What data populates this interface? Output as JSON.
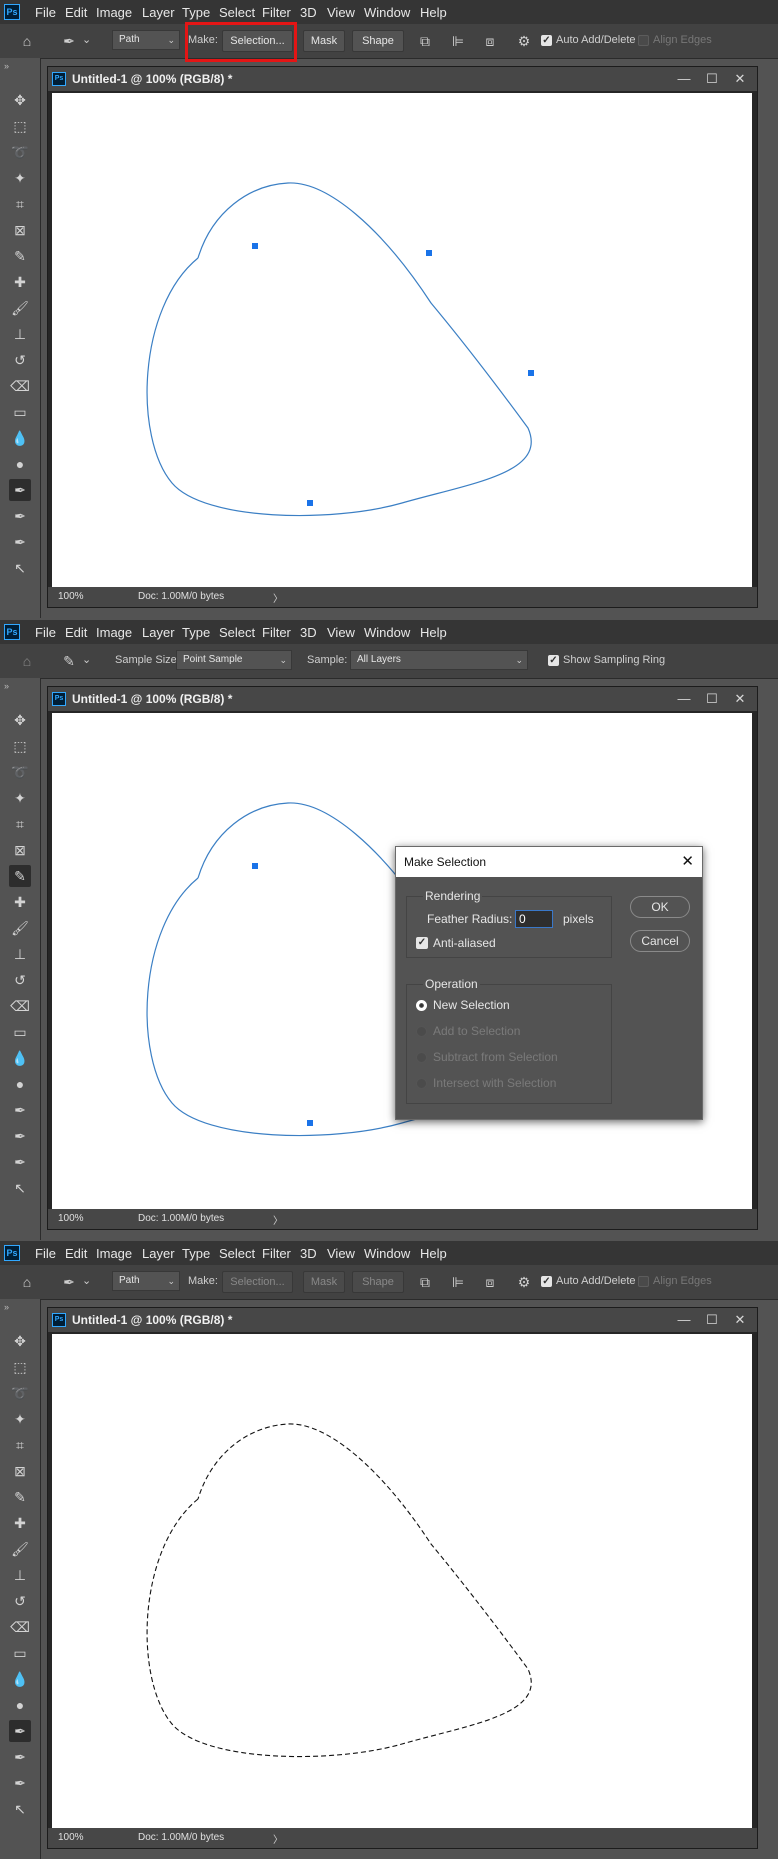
{
  "menu": {
    "logo": "Ps",
    "items": [
      "File",
      "Edit",
      "Image",
      "Layer",
      "Type",
      "Select",
      "Filter",
      "3D",
      "View",
      "Window",
      "Help"
    ]
  },
  "pen_options": {
    "mode_select": "Path",
    "make_label": "Make:",
    "selection_button": "Selection...",
    "mask_button": "Mask",
    "shape_button": "Shape",
    "auto_add_delete": "Auto Add/Delete",
    "align_edges": "Align Edges"
  },
  "eyedropper_options": {
    "sample_size_label": "Sample Size:",
    "sample_size_value": "Point Sample",
    "sample_label": "Sample:",
    "sample_value": "All Layers",
    "show_sampling_ring": "Show Sampling Ring"
  },
  "document": {
    "title": "Untitled-1 @ 100% (RGB/8) *",
    "zoom": "100%",
    "doc_info": "Doc: 1.00M/0 bytes"
  },
  "make_selection_dialog": {
    "title": "Make Selection",
    "rendering_label": "Rendering",
    "feather_radius_label": "Feather Radius:",
    "feather_radius_value": "0",
    "pixels_label": "pixels",
    "anti_aliased_label": "Anti-aliased",
    "operation_label": "Operation",
    "new_selection": "New Selection",
    "add_to_selection": "Add to Selection",
    "subtract_from_selection": "Subtract from Selection",
    "intersect_with_selection": "Intersect with Selection",
    "ok_button": "OK",
    "cancel_button": "Cancel"
  },
  "icons": {
    "home": "home-icon",
    "pen": "pen-tool-icon",
    "eyedropper": "eyedropper-icon",
    "gear": "gear-icon",
    "close": "close-icon"
  },
  "colors": {
    "path_stroke": "#3b7fc4",
    "anchor": "#1a73e8",
    "highlight_box": "#e41515"
  }
}
